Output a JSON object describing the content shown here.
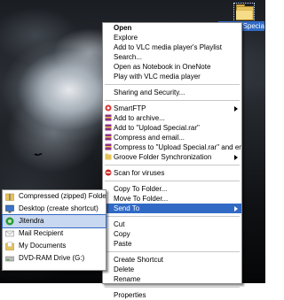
{
  "desktop": {
    "selected_icon": {
      "label": "Upload Special",
      "icon": "folder-icon"
    }
  },
  "context_menu": {
    "groups": [
      [
        {
          "label": "Open",
          "bold": true
        },
        {
          "label": "Explore"
        },
        {
          "label": "Add to VLC media player's Playlist"
        },
        {
          "label": "Search..."
        },
        {
          "label": "Open as Notebook in OneNote"
        },
        {
          "label": "Play with VLC media player"
        }
      ],
      [
        {
          "label": "Sharing and Security..."
        }
      ],
      [
        {
          "label": "SmartFTP",
          "icon": "smartftp-icon",
          "submenu": true
        },
        {
          "label": "Add to archive...",
          "icon": "winrar-icon"
        },
        {
          "label": "Add to \"Upload Special.rar\"",
          "icon": "winrar-icon"
        },
        {
          "label": "Compress and email...",
          "icon": "winrar-icon"
        },
        {
          "label": "Compress to \"Upload Special.rar\" and email",
          "icon": "winrar-icon"
        },
        {
          "label": "Groove Folder Synchronization",
          "icon": "groove-icon",
          "submenu": true
        }
      ],
      [
        {
          "label": "Scan for viruses",
          "icon": "antivirus-icon"
        }
      ],
      [
        {
          "label": "Copy To Folder..."
        },
        {
          "label": "Move To Folder..."
        },
        {
          "label": "Send To",
          "submenu": true,
          "highlight": true
        }
      ],
      [
        {
          "label": "Cut"
        },
        {
          "label": "Copy"
        },
        {
          "label": "Paste"
        }
      ],
      [
        {
          "label": "Create Shortcut"
        },
        {
          "label": "Delete"
        },
        {
          "label": "Rename"
        }
      ],
      [
        {
          "label": "Properties"
        }
      ]
    ]
  },
  "send_to_menu": {
    "items": [
      {
        "label": "Compressed (zipped) Folder",
        "icon": "zip-folder-icon"
      },
      {
        "label": "Desktop (create shortcut)",
        "icon": "desktop-icon"
      },
      {
        "label": "Jitendra",
        "icon": "user-icon",
        "highlight": true
      },
      {
        "label": "Mail Recipient",
        "icon": "mail-icon"
      },
      {
        "label": "My Documents",
        "icon": "my-documents-icon"
      },
      {
        "label": "DVD-RAM Drive (G:)",
        "icon": "dvd-drive-icon"
      }
    ]
  },
  "colors": {
    "highlight": "#316ac5",
    "menu_bg": "#ffffff",
    "winrar": "#8b2f86",
    "folder": "#e6c25a"
  }
}
